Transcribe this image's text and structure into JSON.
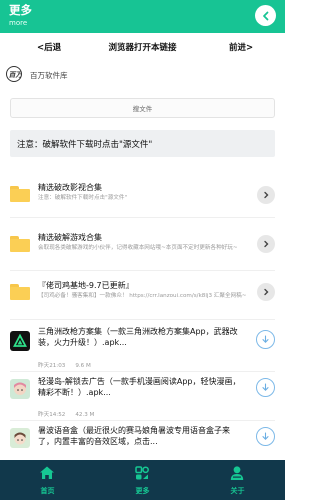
{
  "header": {
    "title": "更多",
    "subtitle": "more",
    "back_icon": "chevron-left-icon",
    "color": "#17c494"
  },
  "nav": {
    "prev": "<后退",
    "open_in_browser": "浏览器打开本链接",
    "next": "前进>"
  },
  "site": {
    "logo_text": "百万",
    "name": "百万软件库"
  },
  "search": {
    "label": "搜文件"
  },
  "notice": {
    "text": "注意：破解软件下载时点击\"源文件\""
  },
  "folders": [
    {
      "name": "精选破改影视合集",
      "desc": "注意：破解软件下载时点击\"源文件\""
    },
    {
      "name": "精选破解游戏合集",
      "desc": "会取现各类破解游戏的小伙伴，记得收藏本网站哦~本页面不定时更新各种好玩~"
    },
    {
      "name": "『佬司鸡基地-9.7已更新』",
      "desc": "【司鸡必备！骚客集和】一款佛众！ https://crr.lanzoui.com/s/k8lj3 汇聚全网稿~"
    }
  ],
  "files": [
    {
      "name": "三角洲改枪方案集（一款三角洲改枪方案集App，武器改装，火力升级！）.apk...",
      "time": "昨天21:03",
      "size": "9.6 M",
      "icon": "delta-app-icon",
      "icon_color": "#111111"
    },
    {
      "name": "轻漫岛-解锁去广告（一款手机漫画阅读App，轻快漫画，精彩不断！）.apk...",
      "time": "昨天14:52",
      "size": "42.3 M",
      "icon": "anime-girl-app-icon",
      "icon_color": "#cfe9d6"
    },
    {
      "name": "暑波语音盒（最近很火的赛马娘角暑波专用语音盒子来了，内置丰富的音效区域，点击...",
      "time": "",
      "size": "",
      "icon": "character-app-icon",
      "icon_color": "#d9ecd7"
    }
  ],
  "tabbar": {
    "color": "#11384b",
    "accent": "#16c793",
    "tabs": [
      {
        "label": "首页",
        "icon": "home-icon"
      },
      {
        "label": "更多",
        "icon": "more-apps-icon"
      },
      {
        "label": "关于",
        "icon": "user-icon"
      }
    ]
  }
}
